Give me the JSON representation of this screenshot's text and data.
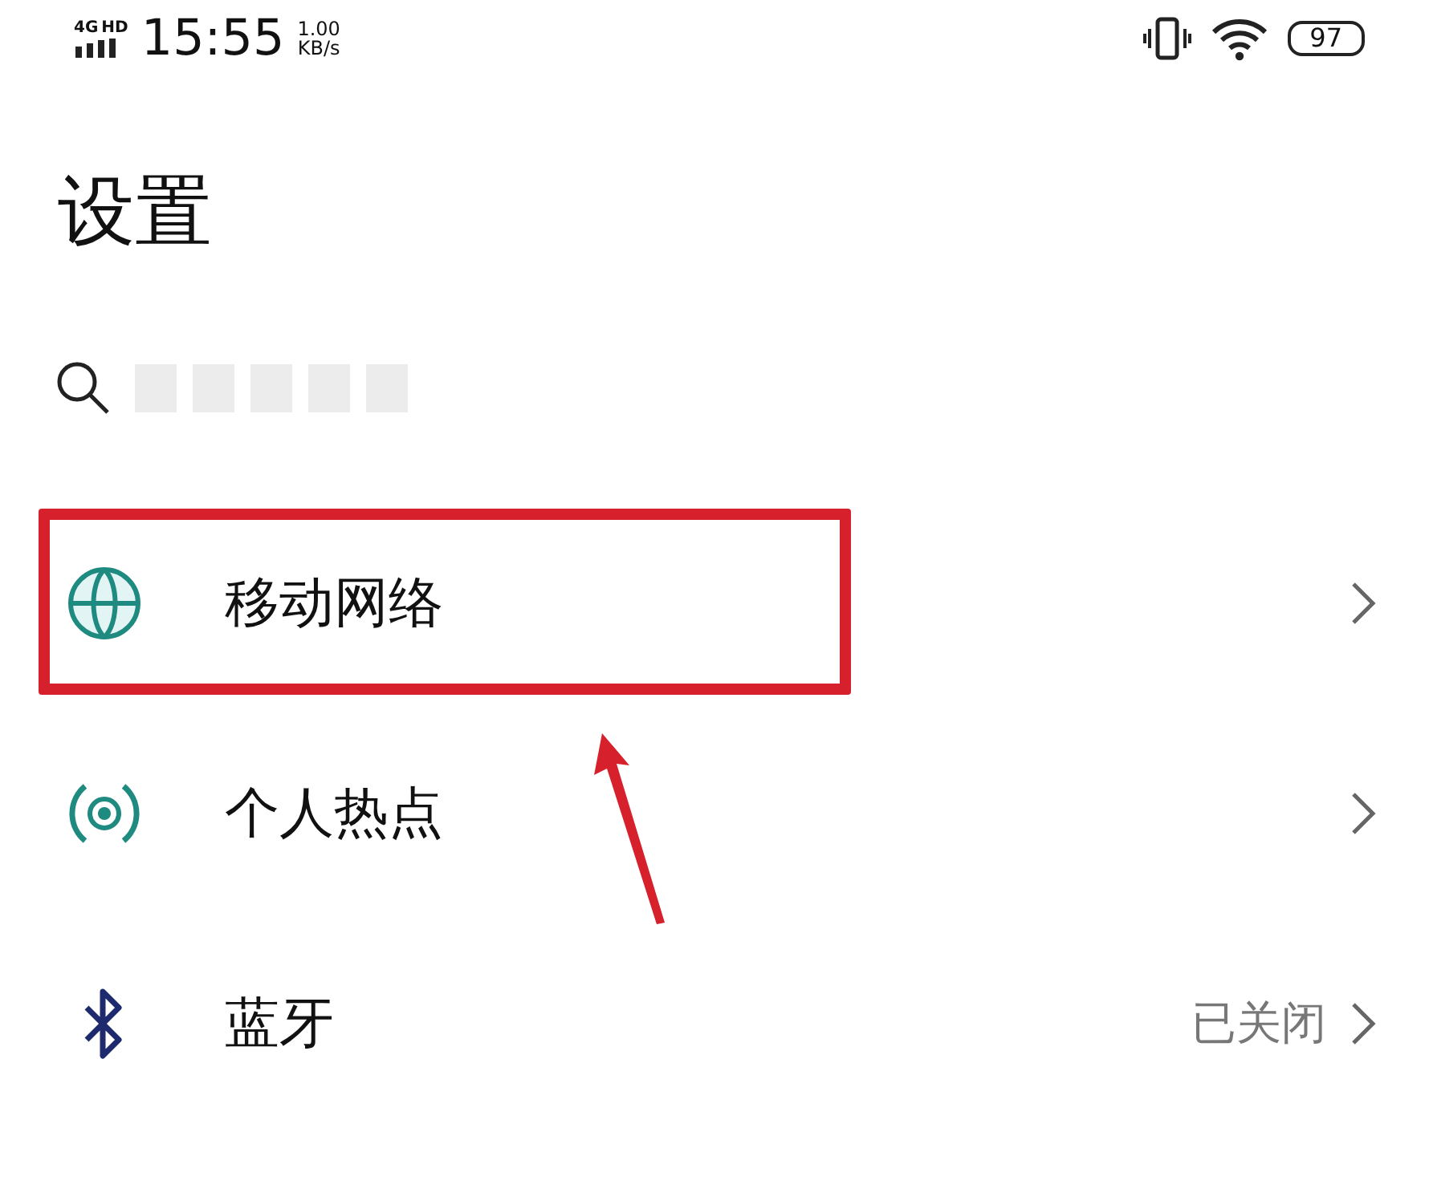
{
  "status_bar": {
    "network": "4G",
    "hd": "HD",
    "time": "15:55",
    "speed_value": "1.00",
    "speed_unit": "KB/s",
    "battery": "97"
  },
  "title": "设置",
  "search": {
    "redacted": true
  },
  "items": [
    {
      "kind": "globe",
      "label": "移动网络",
      "highlighted": true
    },
    {
      "kind": "hotspot",
      "label": "个人热点",
      "highlighted": false
    },
    {
      "kind": "bluetooth",
      "label": "蓝牙",
      "value": "已关闭",
      "highlighted": false
    }
  ]
}
